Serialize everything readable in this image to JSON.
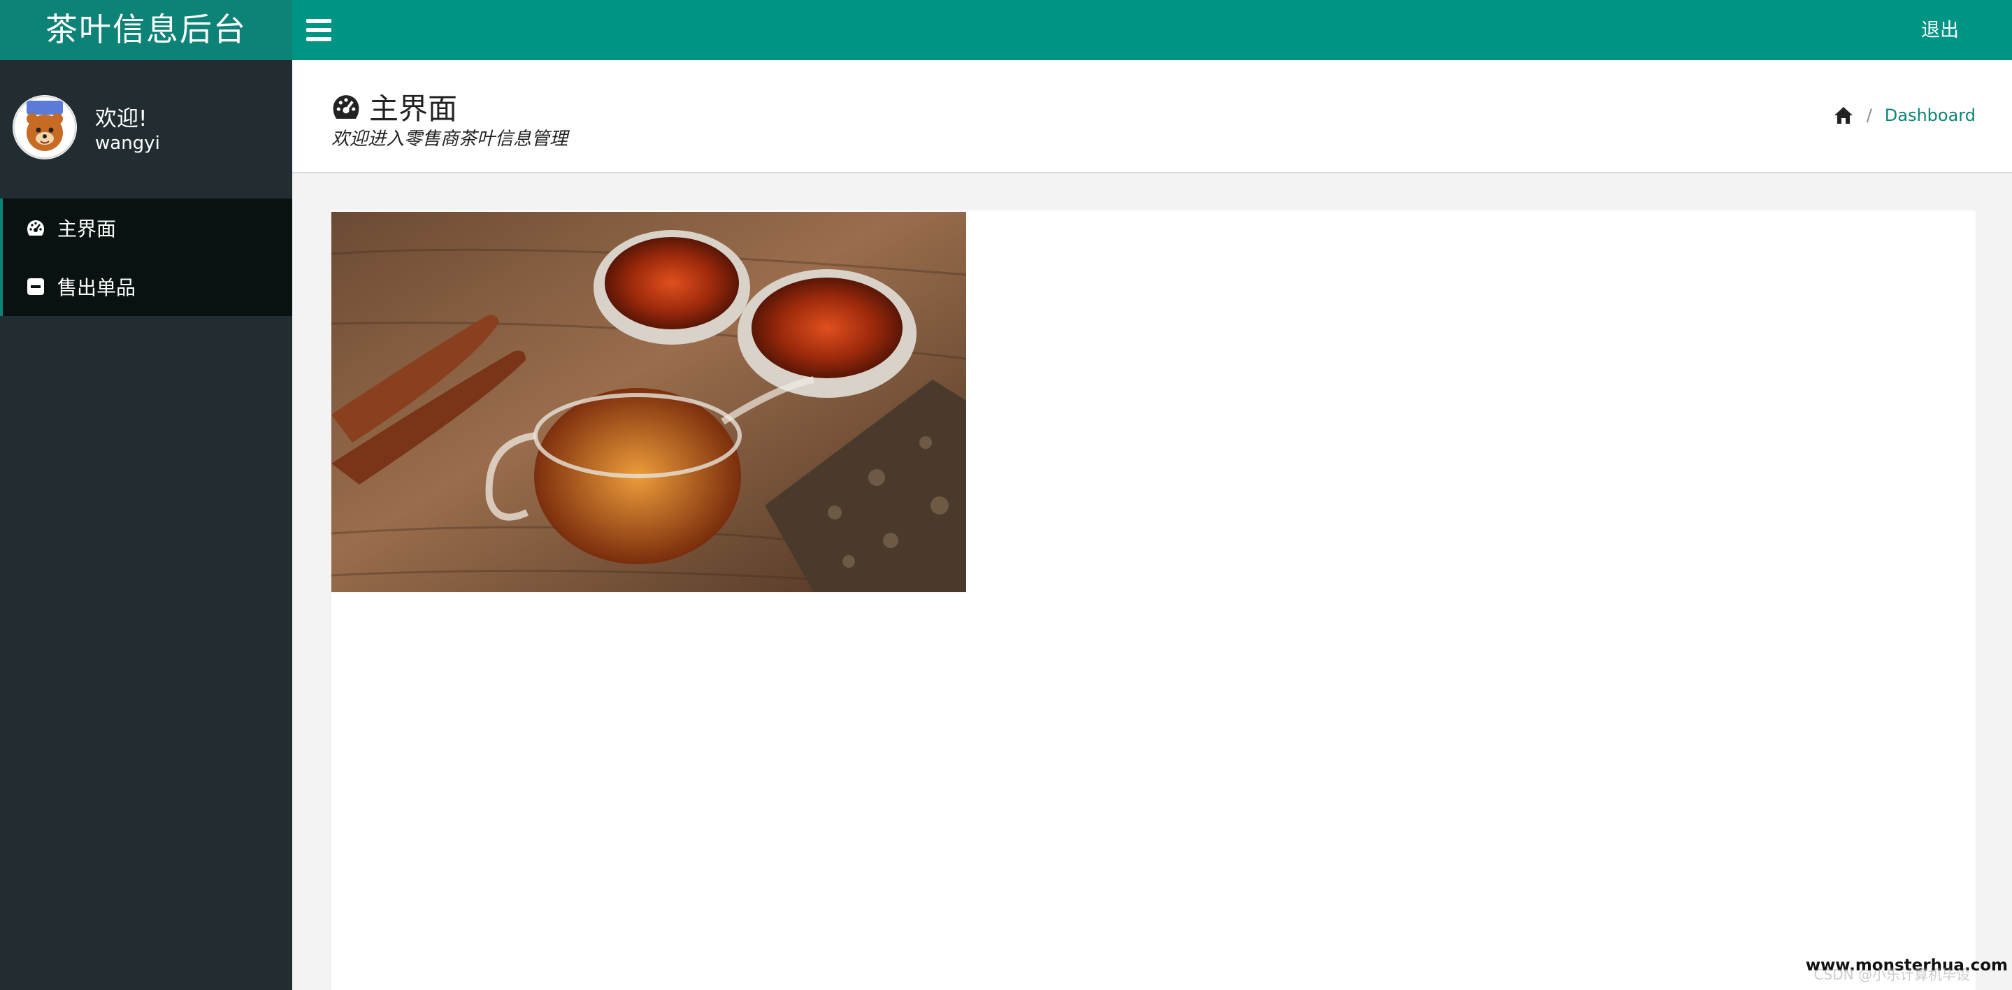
{
  "header": {
    "brand": "茶叶信息后台",
    "logout_label": "退出"
  },
  "sidebar": {
    "welcome": "欢迎!",
    "username": "wangyi",
    "items": [
      {
        "label": "主界面",
        "icon": "dashboard-icon"
      },
      {
        "label": "售出单品",
        "icon": "minus-square-icon"
      }
    ]
  },
  "content_header": {
    "title": "主界面",
    "subtitle": "欢迎进入零售商茶叶信息管理",
    "breadcrumb": {
      "home_icon": "home-icon",
      "separator": "/",
      "current": "Dashboard"
    }
  },
  "watermark": {
    "site": "www.monsterhua.com",
    "csdn": "CSDN @小乐计算机毕设"
  },
  "colors": {
    "header": "#009485",
    "brand": "#0d8377",
    "sidebar": "#222d32",
    "accent": "#0d8377"
  }
}
